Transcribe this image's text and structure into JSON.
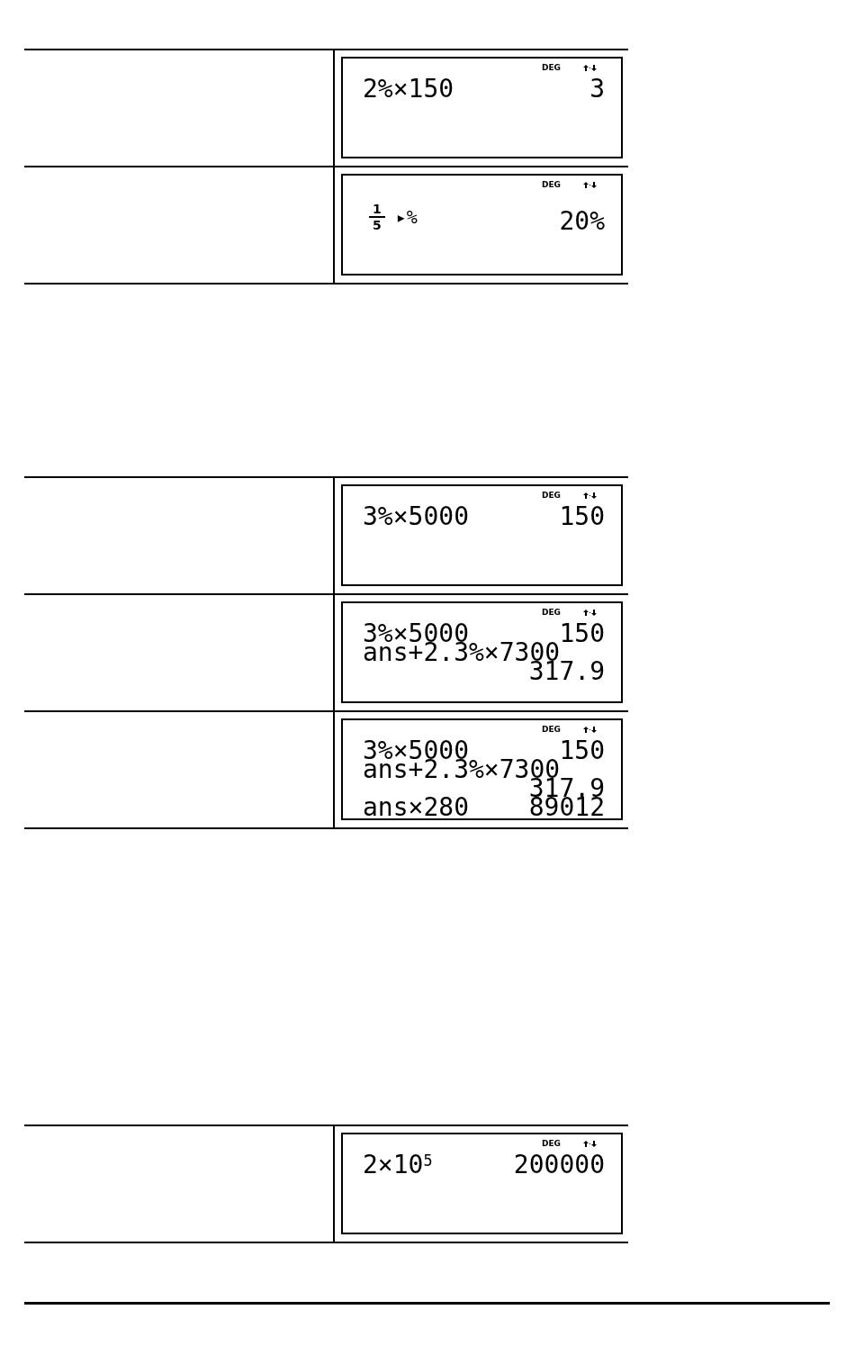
{
  "tables": [
    {
      "rows": [
        {
          "screen": {
            "indicator": "DEG",
            "lines": [
              {
                "kind": "entry",
                "expression": "2%×150",
                "result": "3"
              }
            ]
          }
        },
        {
          "screen": {
            "indicator": "DEG",
            "lines": [
              {
                "kind": "fraction",
                "numerator": "1",
                "denominator": "5",
                "operator": "▸%",
                "result": "20%"
              }
            ]
          }
        }
      ]
    },
    {
      "rows": [
        {
          "screen": {
            "indicator": "DEG",
            "lines": [
              {
                "kind": "entry",
                "expression": "3%×5000",
                "result": "150"
              }
            ]
          }
        },
        {
          "screen": {
            "indicator": "DEG",
            "lines": [
              {
                "kind": "entry",
                "expression": "3%×5000",
                "result": "150"
              },
              {
                "kind": "entry",
                "expression": "ans+2.3%×7300"
              },
              {
                "kind": "entry",
                "result": "317.9"
              }
            ]
          }
        },
        {
          "screen": {
            "indicator": "DEG",
            "lines": [
              {
                "kind": "entry",
                "expression": "3%×5000",
                "result": "150"
              },
              {
                "kind": "entry",
                "expression": "ans+2.3%×7300"
              },
              {
                "kind": "entry",
                "result": "317.9"
              },
              {
                "kind": "entry",
                "expression": "ans×280",
                "result": "89012"
              }
            ]
          }
        }
      ]
    },
    {
      "rows": [
        {
          "screen": {
            "indicator": "DEG",
            "lines": [
              {
                "kind": "entry",
                "expression": "2×10$^{5}$",
                "result": "200000"
              }
            ]
          }
        }
      ]
    }
  ]
}
